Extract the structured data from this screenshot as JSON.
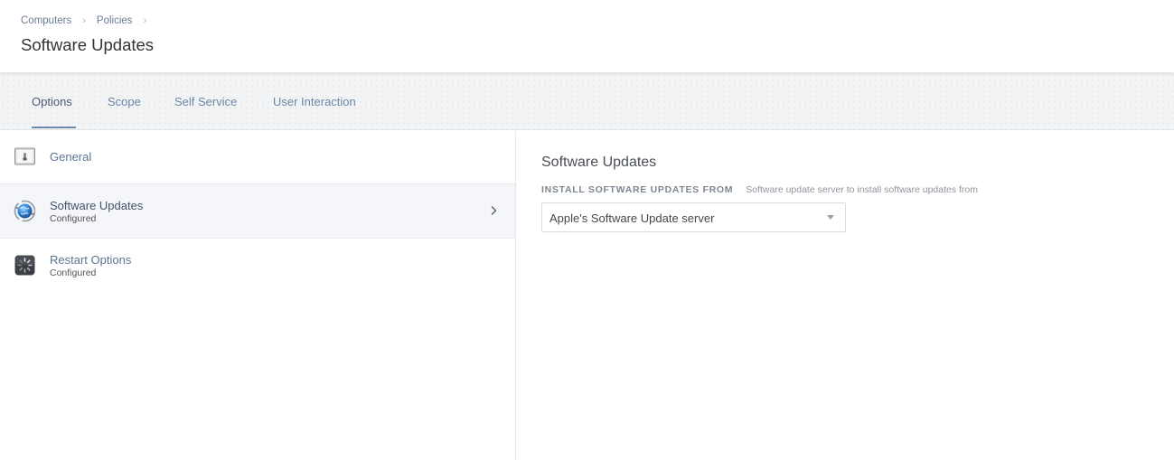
{
  "breadcrumb": {
    "items": [
      "Computers",
      "Policies"
    ],
    "separator": "›"
  },
  "page": {
    "title": "Software Updates"
  },
  "tabs": [
    {
      "label": "Options",
      "active": true
    },
    {
      "label": "Scope",
      "active": false
    },
    {
      "label": "Self Service",
      "active": false
    },
    {
      "label": "User Interaction",
      "active": false
    }
  ],
  "sidebar": {
    "items": [
      {
        "label": "General",
        "subtitle": "",
        "icon": "general-icon",
        "selected": false
      },
      {
        "label": "Software Updates",
        "subtitle": "Configured",
        "icon": "software-update-globe-icon",
        "selected": true
      },
      {
        "label": "Restart Options",
        "subtitle": "Configured",
        "icon": "restart-icon",
        "selected": false
      }
    ]
  },
  "main": {
    "section_title": "Software Updates",
    "field": {
      "label": "INSTALL SOFTWARE UPDATES FROM",
      "hint": "Software update server to install software updates from",
      "value": "Apple's Software Update server"
    }
  },
  "colors": {
    "accent": "#6f8bb1",
    "link": "#6b86a6",
    "tab_background": "#f3f4f6",
    "selected_row": "#f5f6f9"
  }
}
